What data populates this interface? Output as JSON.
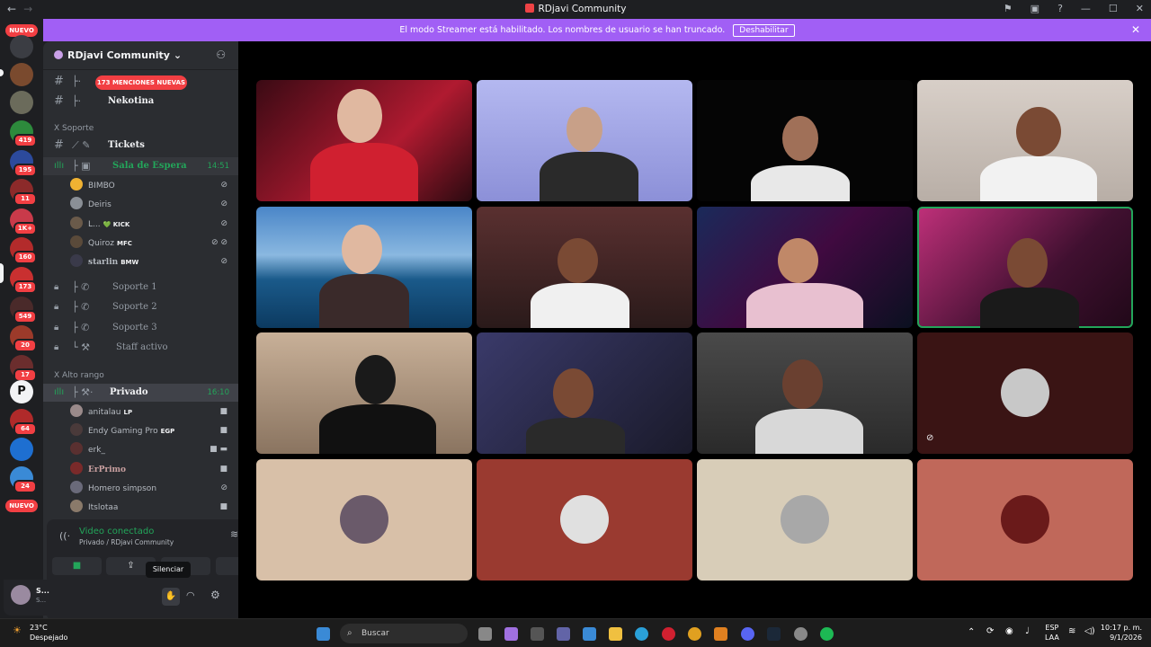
{
  "window": {
    "title": "RDjavi Community"
  },
  "streamer": {
    "message": "El modo Streamer está habilitado. Los nombres de usuario se han truncado.",
    "button": "Deshabilitar"
  },
  "guilds": {
    "nuevo": "NUEVO",
    "badges": [
      "419",
      "195",
      "11",
      "1K+",
      "160",
      "173",
      "549",
      "20",
      "17",
      "64",
      "24"
    ]
  },
  "server": {
    "name": "RDjavi Community"
  },
  "sidebar": {
    "mentions": "173 MENCIONES NUEVAS",
    "channels_top": [
      {
        "name": "Nekotina"
      }
    ],
    "cat_soporte": "X Soporte",
    "tickets": "Tickets",
    "sala": "Sala de Espera",
    "sala_time": "14:51",
    "sala_members": [
      {
        "name": "BIMBO",
        "tag": ""
      },
      {
        "name": "Deiris",
        "tag": ""
      },
      {
        "name": "L...",
        "tag": "💚 KICK"
      },
      {
        "name": "Quiroz",
        "tag": "MFC"
      },
      {
        "name": "starlin",
        "tag": "BMW"
      }
    ],
    "locked": [
      "Soporte 1",
      "Soporte 2",
      "Soporte 3",
      "Staff activo"
    ],
    "cat_alto": "X Alto rango",
    "privado": "Privado",
    "privado_time": "16:10",
    "privado_members": [
      {
        "name": "anitalau",
        "tag": "LP"
      },
      {
        "name": "Endy Gaming Pro",
        "tag": "EGP"
      },
      {
        "name": "erk_",
        "tag": ""
      },
      {
        "name": "ErPrimo",
        "tag": ""
      },
      {
        "name": "Homero simpson",
        "tag": ""
      },
      {
        "name": "Itslotaa",
        "tag": ""
      }
    ]
  },
  "voice": {
    "status": "Video conectado",
    "location": "Privado / RDjavi Community",
    "tooltip": "Silenciar"
  },
  "user": {
    "name": "S...",
    "sub": "S..."
  },
  "taskbar": {
    "temp": "23°C",
    "weather": "Despejado",
    "search": "Buscar",
    "lang1": "ESP",
    "lang2": "LAA",
    "time": "10:17 p. m.",
    "date": "9/1/2026"
  },
  "colors": {
    "accent": "#a15ff5",
    "voice_green": "#23a55a",
    "mention_red": "#f23f43"
  }
}
